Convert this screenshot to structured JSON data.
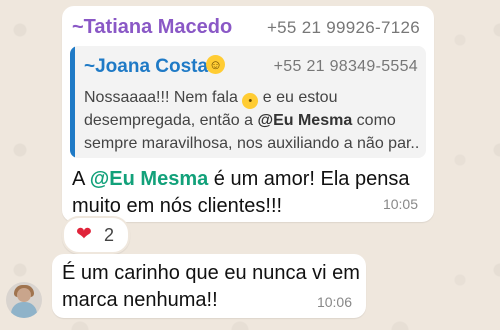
{
  "message1": {
    "sender_name": "~Tatiana Macedo",
    "sender_phone": "+55 21 99926-7126",
    "quoted": {
      "name": "~Joana Costa",
      "name_emoji": "smiling-face-emoji",
      "phone": "+55 21 98349-5554",
      "line1_a": "Nossaaaa!!! Nem fala ",
      "line1_emoji": "face-with-hand-over-mouth-emoji",
      "line1_b": " e eu estou",
      "line2": "desempregada, então a ",
      "line2_mention": "@Eu Mesma",
      "line2_c": "  como",
      "line3": "sempre maravilhosa, nos auxiliando a não par..."
    },
    "text_a": "A ",
    "mention": "@Eu Mesma",
    "text_b": "  é um amor! Ela pensa",
    "text_line2": "muito em nós clientes!!!",
    "time": "10:05",
    "reaction": {
      "emoji": "red-heart-emoji",
      "count": "2"
    }
  },
  "message2": {
    "line1": "É um carinho que eu nunca vi em",
    "line2": "marca nenhuma!!",
    "time": "10:06",
    "avatar": "user-avatar"
  },
  "colors": {
    "sender": "#8a58c6",
    "quote_name": "#1f7ac6",
    "mention": "#12a17a",
    "heart": "#e0243a",
    "background": "#efe7dd"
  }
}
